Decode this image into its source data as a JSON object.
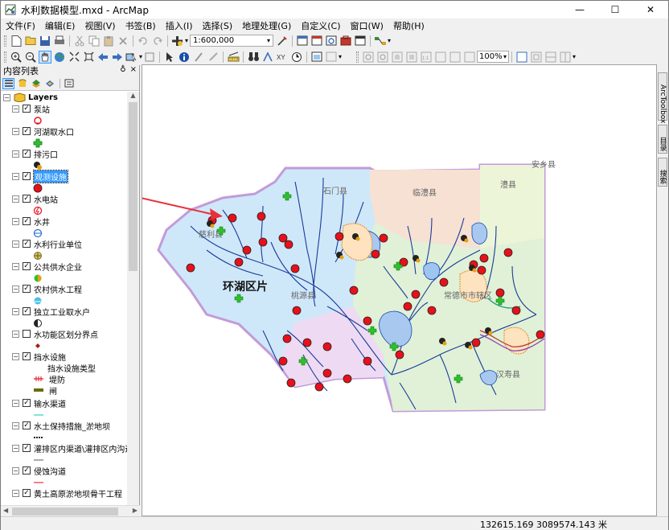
{
  "window": {
    "title": "水利数据模型.mxd - ArcMap",
    "minimize": "—",
    "maximize": "☐",
    "close": "✕"
  },
  "menu": [
    "文件(F)",
    "编辑(E)",
    "视图(V)",
    "书签(B)",
    "插入(I)",
    "选择(S)",
    "地理处理(G)",
    "自定义(C)",
    "窗口(W)",
    "帮助(H)"
  ],
  "toolbar": {
    "scale": "1:600,000",
    "zoom": "100%"
  },
  "toc": {
    "title": "内容列表",
    "pin": "♁",
    "close": "×",
    "root": "Layers",
    "layers": [
      {
        "name": "泵站",
        "checked": true,
        "symbol": "pump-station-symbol"
      },
      {
        "name": "河湖取水口",
        "checked": true,
        "symbol": "green-cross-symbol"
      },
      {
        "name": "排污口",
        "checked": true,
        "symbol": "outfall-symbol"
      },
      {
        "name": "观测设施",
        "checked": true,
        "selected": true,
        "symbol": "red-dot-symbol"
      },
      {
        "name": "水电站",
        "checked": true,
        "symbol": "hydropower-symbol"
      },
      {
        "name": "水井",
        "checked": true,
        "symbol": "well-symbol"
      },
      {
        "name": "水利行业单位",
        "checked": true,
        "symbol": "unit-symbol"
      },
      {
        "name": "公共供水企业",
        "checked": true,
        "symbol": "supply-symbol"
      },
      {
        "name": "农村供水工程",
        "checked": true,
        "symbol": "rural-supply-symbol"
      },
      {
        "name": "独立工业取水户",
        "checked": true,
        "symbol": "industry-symbol"
      },
      {
        "name": "水功能区划分界点",
        "checked": false,
        "symbol": "boundary-point-symbol"
      },
      {
        "name": "挡水设施",
        "checked": true,
        "symbol": "none",
        "sub": [
          "挡水设施类型",
          "堤防",
          "闸"
        ]
      },
      {
        "name": "输水渠道",
        "checked": true,
        "symbol": "canal-symbol"
      },
      {
        "name": "水土保持措施_淤地坝",
        "checked": true,
        "symbol": "dam-symbol"
      },
      {
        "name": "灌排区内渠道\\灌排区内沟道等",
        "checked": true,
        "symbol": "channel-symbol"
      },
      {
        "name": "侵蚀沟道",
        "checked": true,
        "symbol": "gully-symbol"
      },
      {
        "name": "黄土高原淤地坝骨干工程",
        "checked": true,
        "symbol": "none"
      }
    ]
  },
  "map": {
    "labels": [
      "安乡县",
      "临澧县",
      "澧县",
      "石门县",
      "慈利县",
      "环湖区片",
      "桃源县",
      "常德市市辖区",
      "汉寿县"
    ]
  },
  "right_dock": [
    "ArcToolbox",
    "目录",
    "搜索"
  ],
  "status": {
    "coords": "132615.169  3089574.143 米"
  },
  "colors": {
    "selection": "#3399ff",
    "river": "#1a3a9a",
    "station": "#e8101a",
    "arrow": "#e8303a"
  }
}
